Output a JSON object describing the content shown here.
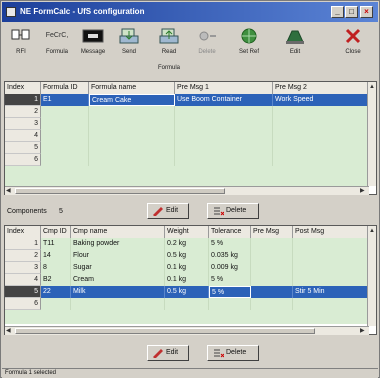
{
  "window": {
    "title": "NE FormCalc - UfS configuration"
  },
  "toolbar": {
    "group_label": "Formula",
    "buttons": [
      {
        "label": "RFI",
        "icon": "document-icon"
      },
      {
        "label": "Formula",
        "icon": "formula-icon"
      },
      {
        "label": "Message",
        "icon": "message-icon"
      },
      {
        "label": "Send",
        "icon": "send-icon"
      },
      {
        "label": "Read",
        "icon": "read-icon"
      },
      {
        "label": "Delete",
        "icon": "delete-icon"
      },
      {
        "label": "Set Ref",
        "icon": "globe-icon"
      },
      {
        "label": "Edit",
        "icon": "edit-icon"
      },
      {
        "label": "Close",
        "icon": "close-icon"
      }
    ],
    "formula_icon_text": "FeCrC,"
  },
  "formulas": {
    "columns": [
      "Index",
      "Formula ID",
      "Formula name",
      "Pre Msg 1",
      "Pre Msg 2"
    ],
    "rows": [
      {
        "index": "1",
        "id": "E1",
        "name": "Cream Cake",
        "msg1": "Use Boom Container",
        "msg2": "Work Speed",
        "selected": true
      },
      {
        "index": "2",
        "id": "",
        "name": "",
        "msg1": "",
        "msg2": "",
        "selected": false
      },
      {
        "index": "3",
        "id": "",
        "name": "",
        "msg1": "",
        "msg2": "",
        "selected": false
      },
      {
        "index": "4",
        "id": "",
        "name": "",
        "msg1": "",
        "msg2": "",
        "selected": false
      },
      {
        "index": "5",
        "id": "",
        "name": "",
        "msg1": "",
        "msg2": "",
        "selected": false
      },
      {
        "index": "6",
        "id": "",
        "name": "",
        "msg1": "",
        "msg2": "",
        "selected": false
      }
    ]
  },
  "mid_bar": {
    "label": "Components",
    "value": "5",
    "edit_label": "Edit",
    "delete_label": "Delete"
  },
  "components": {
    "columns": [
      "Index",
      "Cmp ID",
      "Cmp name",
      "Weight",
      "Tolerance",
      "Pre Msg",
      "Post Msg"
    ],
    "rows": [
      {
        "index": "1",
        "id": "T11",
        "name": "Baking powder",
        "weight": "0.2 kg",
        "tol": "5 %",
        "pre": "",
        "post": "",
        "selected": false
      },
      {
        "index": "2",
        "id": "14",
        "name": "Flour",
        "weight": "0.5 kg",
        "tol": "0.035 kg",
        "pre": "",
        "post": "",
        "selected": false
      },
      {
        "index": "3",
        "id": "8",
        "name": "Sugar",
        "weight": "0.1 kg",
        "tol": "0.009 kg",
        "pre": "",
        "post": "",
        "selected": false
      },
      {
        "index": "4",
        "id": "B2",
        "name": "Cream",
        "weight": "0.1 kg",
        "tol": "5 %",
        "pre": "",
        "post": "",
        "selected": false
      },
      {
        "index": "5",
        "id": "22",
        "name": "Milk",
        "weight": "0.5 kg",
        "tol": "5 %",
        "pre": "",
        "post": "Stir 5 Min",
        "selected": true
      },
      {
        "index": "6",
        "id": "",
        "name": "",
        "weight": "",
        "tol": "",
        "pre": "",
        "post": "",
        "selected": false
      }
    ]
  },
  "bottom_bar": {
    "edit_label": "Edit",
    "delete_label": "Delete"
  },
  "status": {
    "text": "Formula 1 selected"
  },
  "colors": {
    "titlebar": "#1c3f9a",
    "grid_bg": "#d9ecd3",
    "selection": "#2c62b8",
    "window_bg": "#d4d0c8"
  }
}
